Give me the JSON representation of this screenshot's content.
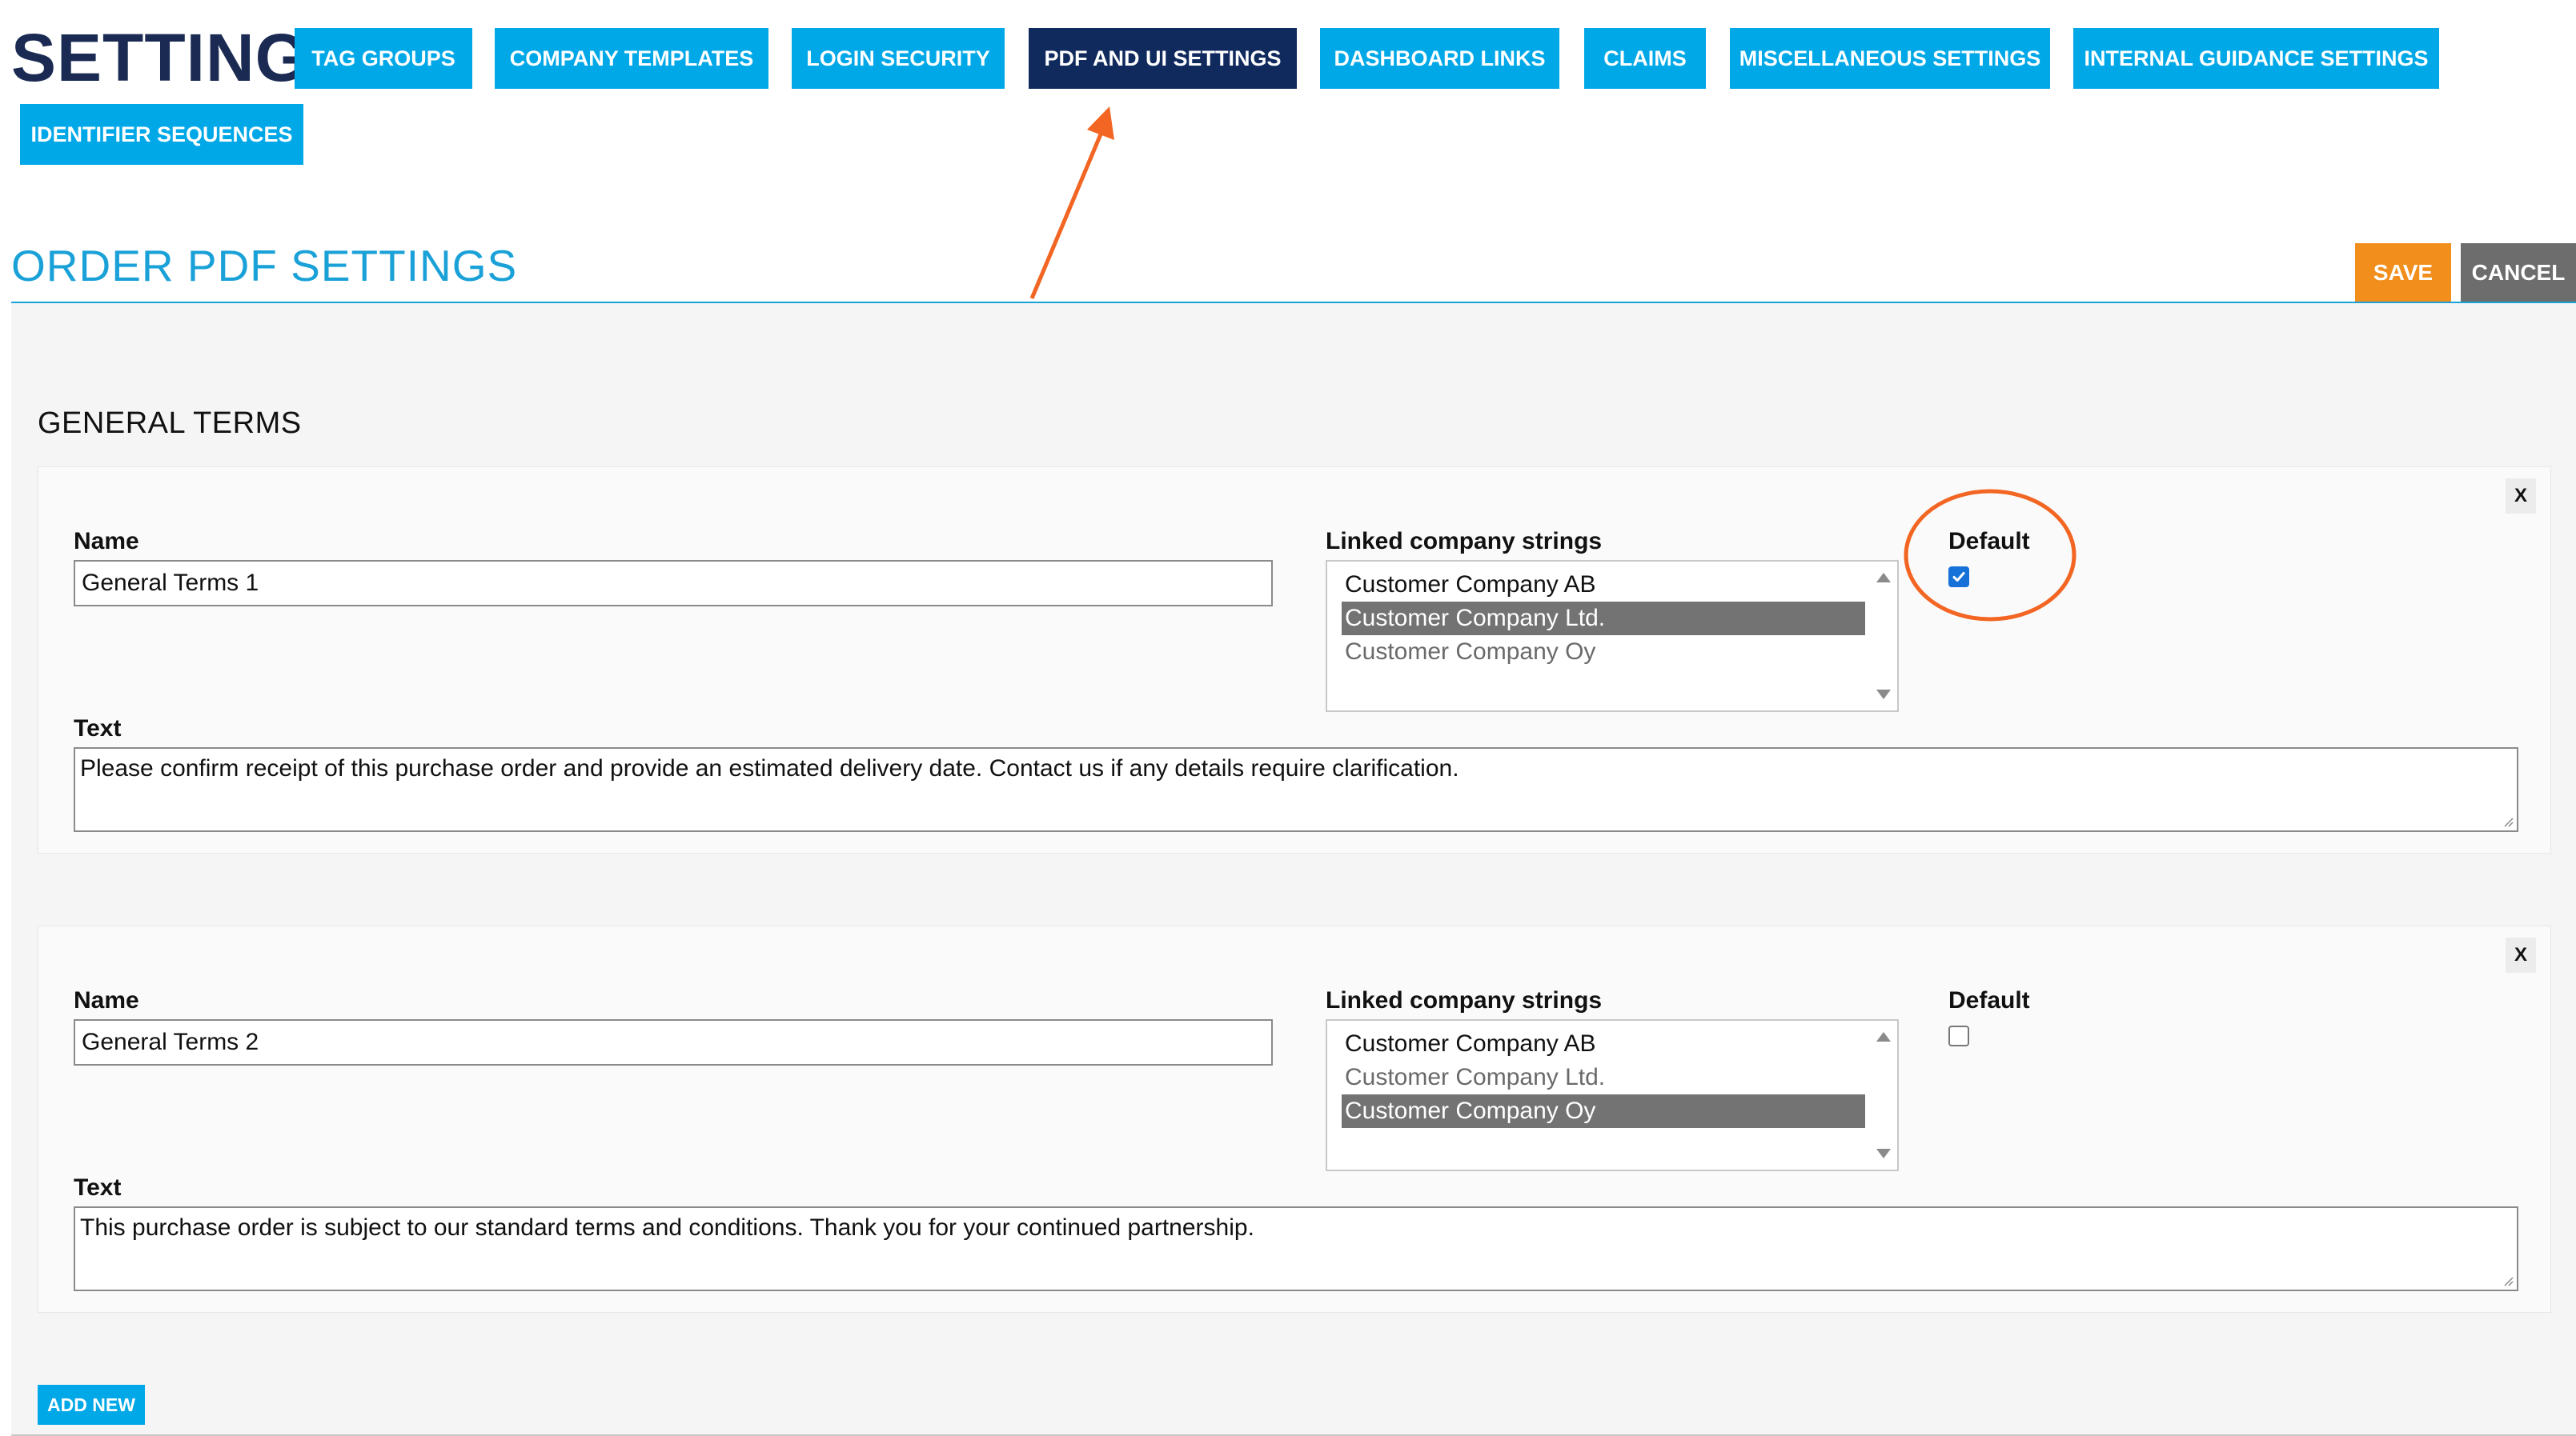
{
  "header": {
    "title": "SETTINGS",
    "tabs": [
      {
        "label": "TAG GROUPS",
        "active": false
      },
      {
        "label": "COMPANY TEMPLATES",
        "active": false
      },
      {
        "label": "LOGIN SECURITY",
        "active": false
      },
      {
        "label": "PDF AND UI SETTINGS",
        "active": true
      },
      {
        "label": "DASHBOARD LINKS",
        "active": false
      },
      {
        "label": "CLAIMS",
        "active": false
      },
      {
        "label": "MISCELLANEOUS SETTINGS",
        "active": false
      },
      {
        "label": "INTERNAL GUIDANCE SETTINGS",
        "active": false
      },
      {
        "label": "IDENTIFIER SEQUENCES",
        "active": false
      }
    ]
  },
  "section": {
    "title": "ORDER PDF SETTINGS",
    "save_label": "SAVE",
    "cancel_label": "CANCEL"
  },
  "general_terms": {
    "title": "GENERAL TERMS",
    "field_labels": {
      "name": "Name",
      "linked": "Linked company strings",
      "default": "Default",
      "text": "Text"
    },
    "close_label": "X",
    "cards": [
      {
        "name": "General Terms 1",
        "linked_options": [
          {
            "label": "Customer Company AB",
            "selected": false
          },
          {
            "label": "Customer Company Ltd.",
            "selected": true
          },
          {
            "label": "Customer Company Oy",
            "selected": false
          }
        ],
        "default": true,
        "text": "Please confirm receipt of this purchase order and provide an estimated delivery date. Contact us if any details require clarification."
      },
      {
        "name": "General Terms 2",
        "linked_options": [
          {
            "label": "Customer Company AB",
            "selected": false
          },
          {
            "label": "Customer Company Ltd.",
            "selected": false
          },
          {
            "label": "Customer Company Oy",
            "selected": true
          }
        ],
        "default": false,
        "text": "This purchase order is subject to our standard terms and conditions. Thank you for your continued partnership."
      }
    ],
    "add_new_label": "ADD NEW"
  },
  "colors": {
    "tab": "#00a8e8",
    "tab_active": "#102a5e",
    "section_title": "#1aa1d8",
    "save": "#f28e1c",
    "cancel": "#6d6d6d",
    "annotation": "#f26522",
    "checkbox": "#1672d9"
  }
}
